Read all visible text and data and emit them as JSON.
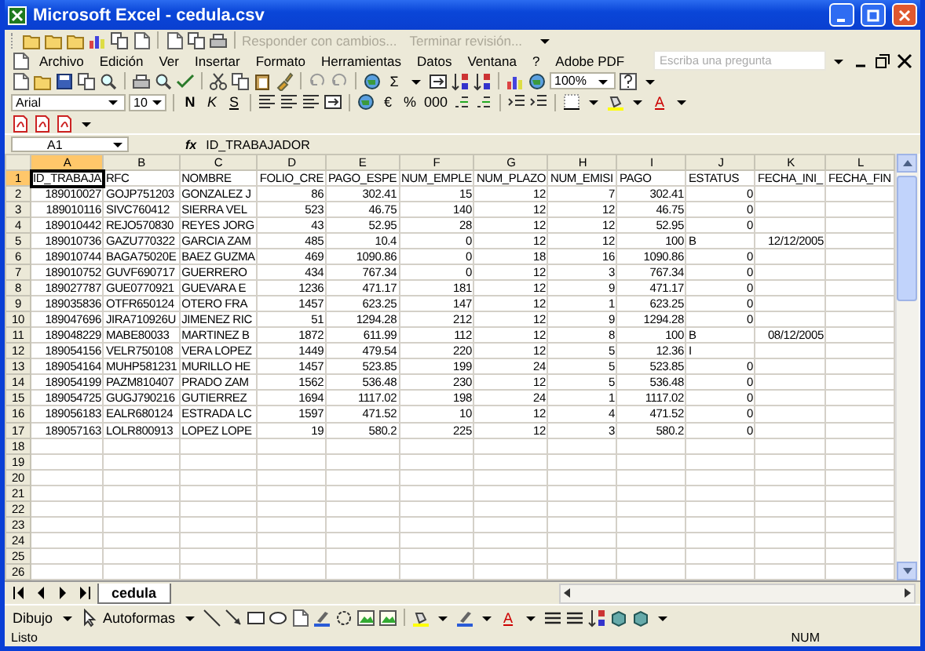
{
  "window": {
    "title": "Microsoft Excel - cedula.csv"
  },
  "review_toolbar": {
    "items": [
      {
        "label": "Responder con cambios...",
        "disabled": true
      },
      {
        "label": "Terminar revisión...",
        "disabled": true
      }
    ]
  },
  "menu": [
    "Archivo",
    "Edición",
    "Ver",
    "Insertar",
    "Formato",
    "Herramientas",
    "Datos",
    "Ventana",
    "?",
    "Adobe PDF"
  ],
  "help_search": {
    "placeholder": "Escriba una pregunta"
  },
  "standard_toolbar": {
    "sum": "Σ",
    "zoom": "100%"
  },
  "formatting_toolbar": {
    "font": "Arial",
    "size": "10",
    "bold": "N",
    "italic": "K",
    "underline": "S",
    "currency": "€",
    "percent": "%",
    "thousands": "000",
    "font_color": "A"
  },
  "formula_bar": {
    "name_box": "A1",
    "function_label": "fx",
    "content": "ID_TRABAJADOR"
  },
  "sheet": {
    "columns": [
      {
        "label": "A",
        "kind": "number",
        "selected": true
      },
      {
        "label": "B",
        "kind": "text",
        "selected": false
      },
      {
        "label": "C",
        "kind": "text",
        "selected": false
      },
      {
        "label": "D",
        "kind": "number",
        "selected": false
      },
      {
        "label": "E",
        "kind": "number",
        "selected": false
      },
      {
        "label": "F",
        "kind": "number",
        "selected": false
      },
      {
        "label": "G",
        "kind": "number",
        "selected": false
      },
      {
        "label": "H",
        "kind": "number",
        "selected": false
      },
      {
        "label": "I",
        "kind": "number",
        "selected": false
      },
      {
        "label": "J",
        "kind": "number",
        "selected": false
      },
      {
        "label": "K",
        "kind": "number",
        "selected": false
      },
      {
        "label": "L",
        "kind": "number",
        "selected": false
      }
    ],
    "rows": [
      {
        "number": "1",
        "kind": "header",
        "selected": true,
        "cells": [
          {
            "text": "ID_TRABAJA",
            "kind": "text",
            "active": true
          },
          "RFC",
          "NOMBRE",
          "FOLIO_CRE",
          "PAGO_ESPE",
          "NUM_EMPLE",
          "NUM_PLAZO",
          "NUM_EMISI",
          "PAGO",
          "ESTATUS",
          "FECHA_INI_",
          "FECHA_FIN"
        ]
      },
      {
        "number": "2",
        "kind": "data",
        "selected": false,
        "cells": [
          "189010027",
          "GOJP751203",
          "GONZALEZ J",
          "86",
          "302.41",
          "15",
          "12",
          "7",
          "302.41",
          "0",
          null,
          null
        ]
      },
      {
        "number": "3",
        "kind": "data",
        "selected": false,
        "cells": [
          "189010116",
          "SIVC760412",
          "SIERRA VEL",
          "523",
          "46.75",
          "140",
          "12",
          "12",
          "46.75",
          "0",
          null,
          null
        ]
      },
      {
        "number": "4",
        "kind": "data",
        "selected": false,
        "cells": [
          "189010442",
          "REJO570830",
          "REYES JORG",
          "43",
          "52.95",
          "28",
          "12",
          "12",
          "52.95",
          "0",
          null,
          null
        ]
      },
      {
        "number": "5",
        "kind": "data",
        "selected": false,
        "cells": [
          "189010736",
          "GAZU770322",
          "GARCIA ZAM",
          "485",
          "10.4",
          "0",
          "12",
          "12",
          "100",
          {
            "text": "B",
            "kind": "text"
          },
          "12/12/2005",
          null
        ]
      },
      {
        "number": "6",
        "kind": "data",
        "selected": false,
        "cells": [
          "189010744",
          "BAGA75020E",
          "BAEZ GUZMA",
          "469",
          "1090.86",
          "0",
          "18",
          "16",
          "1090.86",
          "0",
          null,
          null
        ]
      },
      {
        "number": "7",
        "kind": "data",
        "selected": false,
        "cells": [
          "189010752",
          "GUVF690717",
          "GUERRERO",
          "434",
          "767.34",
          "0",
          "12",
          "3",
          "767.34",
          "0",
          null,
          null
        ]
      },
      {
        "number": "8",
        "kind": "data",
        "selected": false,
        "cells": [
          "189027787",
          "GUE0770921",
          "GUEVARA E",
          "1236",
          "471.17",
          "181",
          "12",
          "9",
          "471.17",
          "0",
          null,
          null
        ]
      },
      {
        "number": "9",
        "kind": "data",
        "selected": false,
        "cells": [
          "189035836",
          "OTFR650124",
          "OTERO FRA",
          "1457",
          "623.25",
          "147",
          "12",
          "1",
          "623.25",
          "0",
          null,
          null
        ]
      },
      {
        "number": "10",
        "kind": "data",
        "selected": false,
        "cells": [
          "189047696",
          "JIRA710926U",
          "JIMENEZ RIC",
          "51",
          "1294.28",
          "212",
          "12",
          "9",
          "1294.28",
          "0",
          null,
          null
        ]
      },
      {
        "number": "11",
        "kind": "data",
        "selected": false,
        "cells": [
          "189048229",
          "MABE80033",
          "MARTINEZ B",
          "1872",
          "611.99",
          "112",
          "12",
          "8",
          "100",
          {
            "text": "B",
            "kind": "text"
          },
          "08/12/2005",
          null
        ]
      },
      {
        "number": "12",
        "kind": "data",
        "selected": false,
        "cells": [
          "189054156",
          "VELR750108",
          "VERA LOPEZ",
          "1449",
          "479.54",
          "220",
          "12",
          "5",
          "12.36",
          {
            "text": "I",
            "kind": "text"
          },
          null,
          null
        ]
      },
      {
        "number": "13",
        "kind": "data",
        "selected": false,
        "cells": [
          "189054164",
          "MUHP581231",
          "MURILLO HE",
          "1457",
          "523.85",
          "199",
          "24",
          "5",
          "523.85",
          "0",
          null,
          null
        ]
      },
      {
        "number": "14",
        "kind": "data",
        "selected": false,
        "cells": [
          "189054199",
          "PAZM810407",
          "PRADO ZAM",
          "1562",
          "536.48",
          "230",
          "12",
          "5",
          "536.48",
          "0",
          null,
          null
        ]
      },
      {
        "number": "15",
        "kind": "data",
        "selected": false,
        "cells": [
          "189054725",
          "GUGJ790216",
          "GUTIERREZ",
          "1694",
          "1117.02",
          "198",
          "24",
          "1",
          "1117.02",
          "0",
          null,
          null
        ]
      },
      {
        "number": "16",
        "kind": "data",
        "selected": false,
        "cells": [
          "189056183",
          "EALR680124",
          "ESTRADA LC",
          "1597",
          "471.52",
          "10",
          "12",
          "4",
          "471.52",
          "0",
          null,
          null
        ]
      },
      {
        "number": "17",
        "kind": "data",
        "selected": false,
        "cells": [
          "189057163",
          "LOLR800913",
          "LOPEZ LOPE",
          "19",
          "580.2",
          "225",
          "12",
          "3",
          "580.2",
          "0",
          null,
          null
        ]
      },
      {
        "number": "18",
        "kind": "data",
        "selected": false,
        "cells": []
      },
      {
        "number": "19",
        "kind": "data",
        "selected": false,
        "cells": []
      },
      {
        "number": "20",
        "kind": "data",
        "selected": false,
        "cells": []
      },
      {
        "number": "21",
        "kind": "data",
        "selected": false,
        "cells": []
      },
      {
        "number": "22",
        "kind": "data",
        "selected": false,
        "cells": []
      },
      {
        "number": "23",
        "kind": "data",
        "selected": false,
        "cells": []
      },
      {
        "number": "24",
        "kind": "data",
        "selected": false,
        "cells": []
      },
      {
        "number": "25",
        "kind": "data",
        "selected": false,
        "cells": []
      },
      {
        "number": "26",
        "kind": "data",
        "selected": false,
        "cells": []
      }
    ]
  },
  "sheet_tabs": [
    {
      "label": "cedula",
      "selected": true
    }
  ],
  "drawing_toolbar": {
    "draw_menu": "Dibujo",
    "autoshapes_menu": "Autoformas",
    "font_color": "A"
  },
  "status_bar": {
    "mode": "Listo",
    "num_lock": "NUM"
  }
}
